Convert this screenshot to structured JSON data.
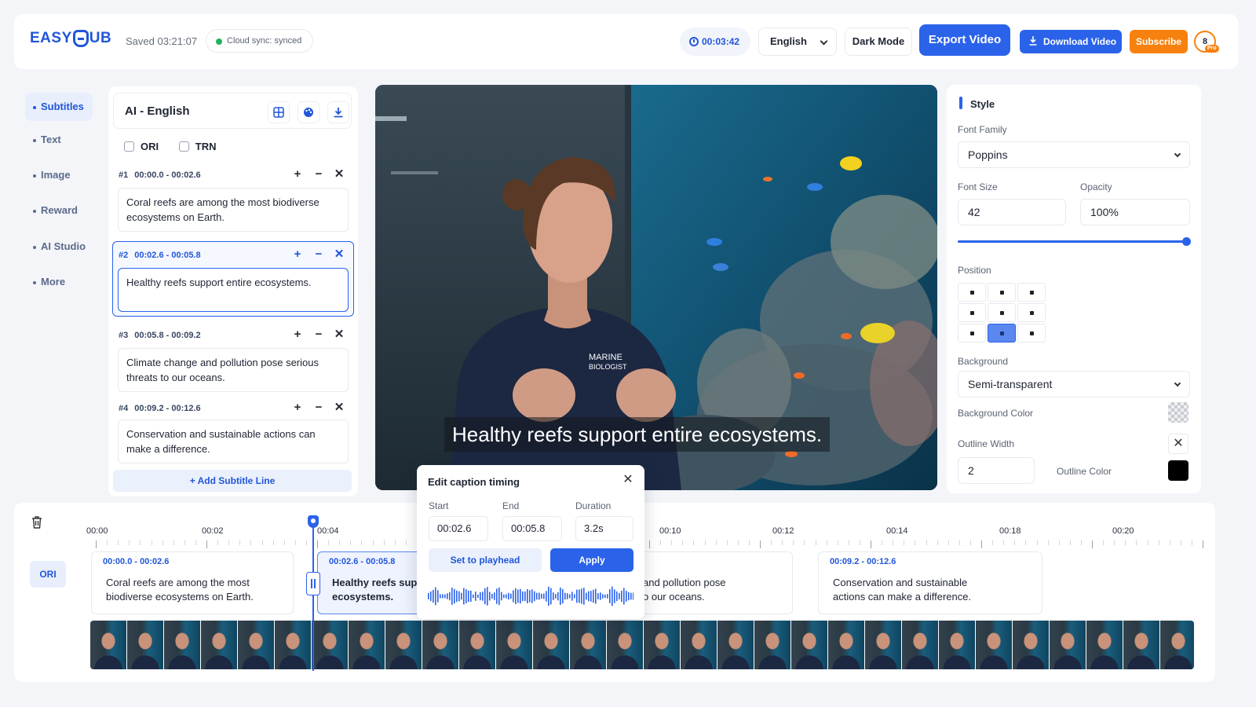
{
  "app": {
    "logo": "EASY",
    "logo_tail": "UB",
    "saved": "Saved 03:21:07",
    "sync": "Cloud sync: synced"
  },
  "toolbar": {
    "timecode": "00:03:42",
    "language": "English",
    "dark_mode": "Dark Mode",
    "export": "Export Video",
    "download": "Download Video",
    "subscribe": "Subscribe",
    "avatar": "8",
    "avatar_badge": "Pro"
  },
  "nav": {
    "items": [
      {
        "label": "Subtitles",
        "active": true
      },
      {
        "label": "Text"
      },
      {
        "label": "Image"
      },
      {
        "label": "Reward"
      },
      {
        "label": "AI Studio"
      },
      {
        "label": "More"
      }
    ]
  },
  "subtitles": {
    "title": "AI - English",
    "ori": "ORI",
    "trn": "TRN",
    "cues": [
      {
        "num": "#1",
        "range": "00:00.0 - 00:02.6",
        "text": "Coral reefs are among the most biodiverse ecosystems on Earth."
      },
      {
        "num": "#2",
        "range": "00:02.6 - 00:05.8",
        "text": "Healthy reefs support entire ecosystems.",
        "active": true
      },
      {
        "num": "#3",
        "range": "00:05.8 - 00:09.2",
        "text": "Climate change and pollution pose serious threats to our oceans."
      },
      {
        "num": "#4",
        "range": "00:09.2 - 00:12.6",
        "text": "Conservation and sustainable actions can make a difference."
      }
    ],
    "add_line": "+ Add Subtitle Line"
  },
  "video": {
    "caption": "Healthy reefs support entire ecosystems.",
    "shirt_line1": "MARINE",
    "shirt_line2": "BIOLOGIST"
  },
  "style": {
    "title": "Style",
    "font_family_label": "Font Family",
    "font_family": "Poppins",
    "font_size_label": "Font Size",
    "font_size": "42",
    "opacity_label": "Opacity",
    "opacity": "100%",
    "opacity_fraction": 1.0,
    "position_label": "Position",
    "position_selected": "bottom-center",
    "background_label": "Background",
    "background": "Semi-transparent",
    "background_color_label": "Background Color",
    "outline_width_label": "Outline Width",
    "outline_width": "2",
    "outline_color_label": "Outline Color",
    "outline_color": "#000000"
  },
  "timeline": {
    "ticks": [
      "00:00",
      "00:02",
      "00:04",
      "00:10",
      "00:12",
      "00:14",
      "00:18",
      "00:20"
    ],
    "track": "ORI",
    "clips": [
      {
        "range": "00:00.0 - 00:02.6",
        "line1": "Coral reefs are among the most",
        "line2": "biodiverse ecosystems on Earth."
      },
      {
        "range": "00:02.6 - 00:05.8",
        "line1": "Healthy reefs support entire",
        "line2": "ecosystems.",
        "active": true
      },
      {
        "range": "",
        "line1": "and pollution pose",
        "line2": "o our oceans."
      },
      {
        "range": "00:09.2 - 00:12.6",
        "line1": "Conservation and sustainable",
        "line2": "actions can make a difference."
      }
    ]
  },
  "popover": {
    "title": "Edit caption timing",
    "start_label": "Start",
    "start": "00:02.6",
    "end_label": "End",
    "end": "00:05.8",
    "duration_label": "Duration",
    "duration": "3.2s",
    "set_playhead": "Set to playhead",
    "apply": "Apply"
  },
  "colors": {
    "accent": "#2a62ea",
    "subscribe": "#f7810f",
    "sync_ok": "#22b35d"
  }
}
